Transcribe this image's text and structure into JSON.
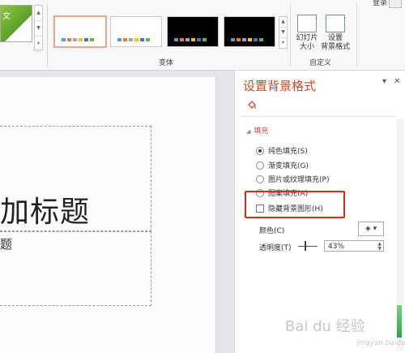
{
  "header": {
    "login": "登录"
  },
  "ribbon": {
    "theme_thumb_text": "文",
    "variants_group": "变体",
    "customize_group": "自定义",
    "slide_size_label": "幻灯片\n大小",
    "bg_format_label": "设置\n背景格式",
    "variants": [
      {
        "bg": "#ffffff",
        "selected": true
      },
      {
        "bg": "#ffffff",
        "selected": false
      },
      {
        "bg": "#000000",
        "selected": false
      },
      {
        "bg": "#000000",
        "selected": false
      }
    ]
  },
  "slide": {
    "title_text": "加标题",
    "subtitle_text": "题"
  },
  "pane": {
    "title": "设置背景格式",
    "section": "填充",
    "options": [
      "纯色填充(S)",
      "渐变填充(G)",
      "图片或纹理填充(P)",
      "图案填充(A)"
    ],
    "selected_option": 0,
    "hide_bg_graphics": "隐藏背景图形(H)",
    "color_label": "颜色(C)",
    "transparency_label": "透明度(T)",
    "transparency_value": "43%"
  },
  "watermark": {
    "text": "Bai du 经验",
    "sub": "jingyan.baidu.com"
  },
  "colors": {
    "accent": "#d24726",
    "highlight": "#e0261e"
  }
}
